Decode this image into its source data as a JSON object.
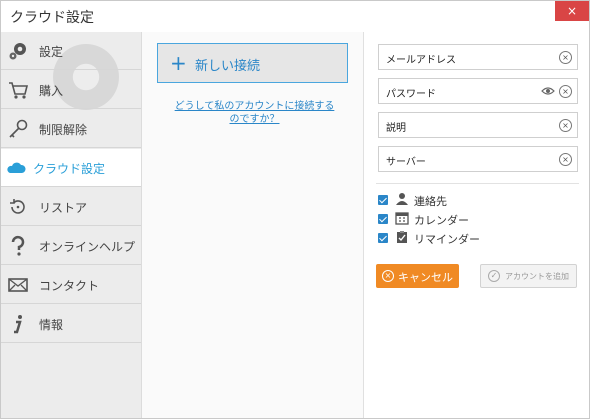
{
  "window": {
    "title": "クラウド設定",
    "close_glyph": "×"
  },
  "sidebar": {
    "items": [
      {
        "label": "設定",
        "icon": "gear-icon"
      },
      {
        "label": "購入",
        "icon": "cart-icon"
      },
      {
        "label": "制限解除",
        "icon": "key-icon"
      },
      {
        "label": "クラウド設定",
        "icon": "cloud-icon",
        "active": true
      },
      {
        "label": "リストア",
        "icon": "restore-icon"
      },
      {
        "label": "オンラインヘルプ",
        "icon": "question-icon"
      },
      {
        "label": "コンタクト",
        "icon": "mail-icon"
      },
      {
        "label": "情報",
        "icon": "info-icon"
      }
    ]
  },
  "middle": {
    "new_connection": {
      "plus": "+",
      "label": "新しい接続"
    },
    "help_link": "どうして私のアカウントに接続するのですか？"
  },
  "form": {
    "email": "メールアドレス",
    "password": "パスワード",
    "description": "説明",
    "server": "サーバー",
    "clear_glyph": "×"
  },
  "sync": {
    "contacts": "連絡先",
    "calendar": "カレンダー",
    "reminders": "リマインダー"
  },
  "actions": {
    "cancel": "キャンセル",
    "cancel_glyph": "×",
    "add_account": "アカウントを追加",
    "add_glyph": "✓"
  },
  "colors": {
    "accent": "#2a86c8",
    "active_text": "#2a9fd8",
    "cancel_bg": "#f08a24",
    "close_bg": "#d94545"
  }
}
